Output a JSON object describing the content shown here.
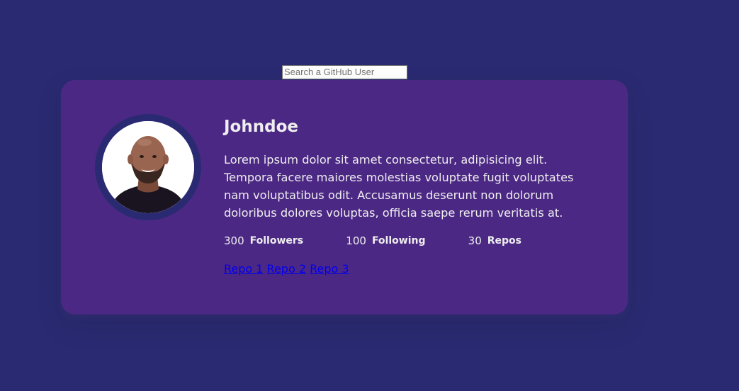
{
  "search": {
    "placeholder": "Search a GitHub User",
    "value": ""
  },
  "user": {
    "name": "Johndoe",
    "avatar_icon": "avatar-photo",
    "bio": "Lorem ipsum dolor sit amet consectetur, adipisicing elit. Tempora facere maiores molestias voluptate fugit voluptates nam voluptatibus odit. Accusamus deserunt non dolorum doloribus dolores voluptas, officia saepe rerum veritatis at."
  },
  "stats": [
    {
      "value": "300",
      "label": "Followers"
    },
    {
      "value": "100",
      "label": "Following"
    },
    {
      "value": "30",
      "label": "Repos"
    }
  ],
  "repos": [
    {
      "label": "Repo 1"
    },
    {
      "label": "Repo 2"
    },
    {
      "label": "Repo 3"
    }
  ],
  "colors": {
    "background": "#2a2a72",
    "card": "#4c2885",
    "avatar_border": "#2a2a72",
    "text": "#eeeeee",
    "link": "#0000ee"
  }
}
